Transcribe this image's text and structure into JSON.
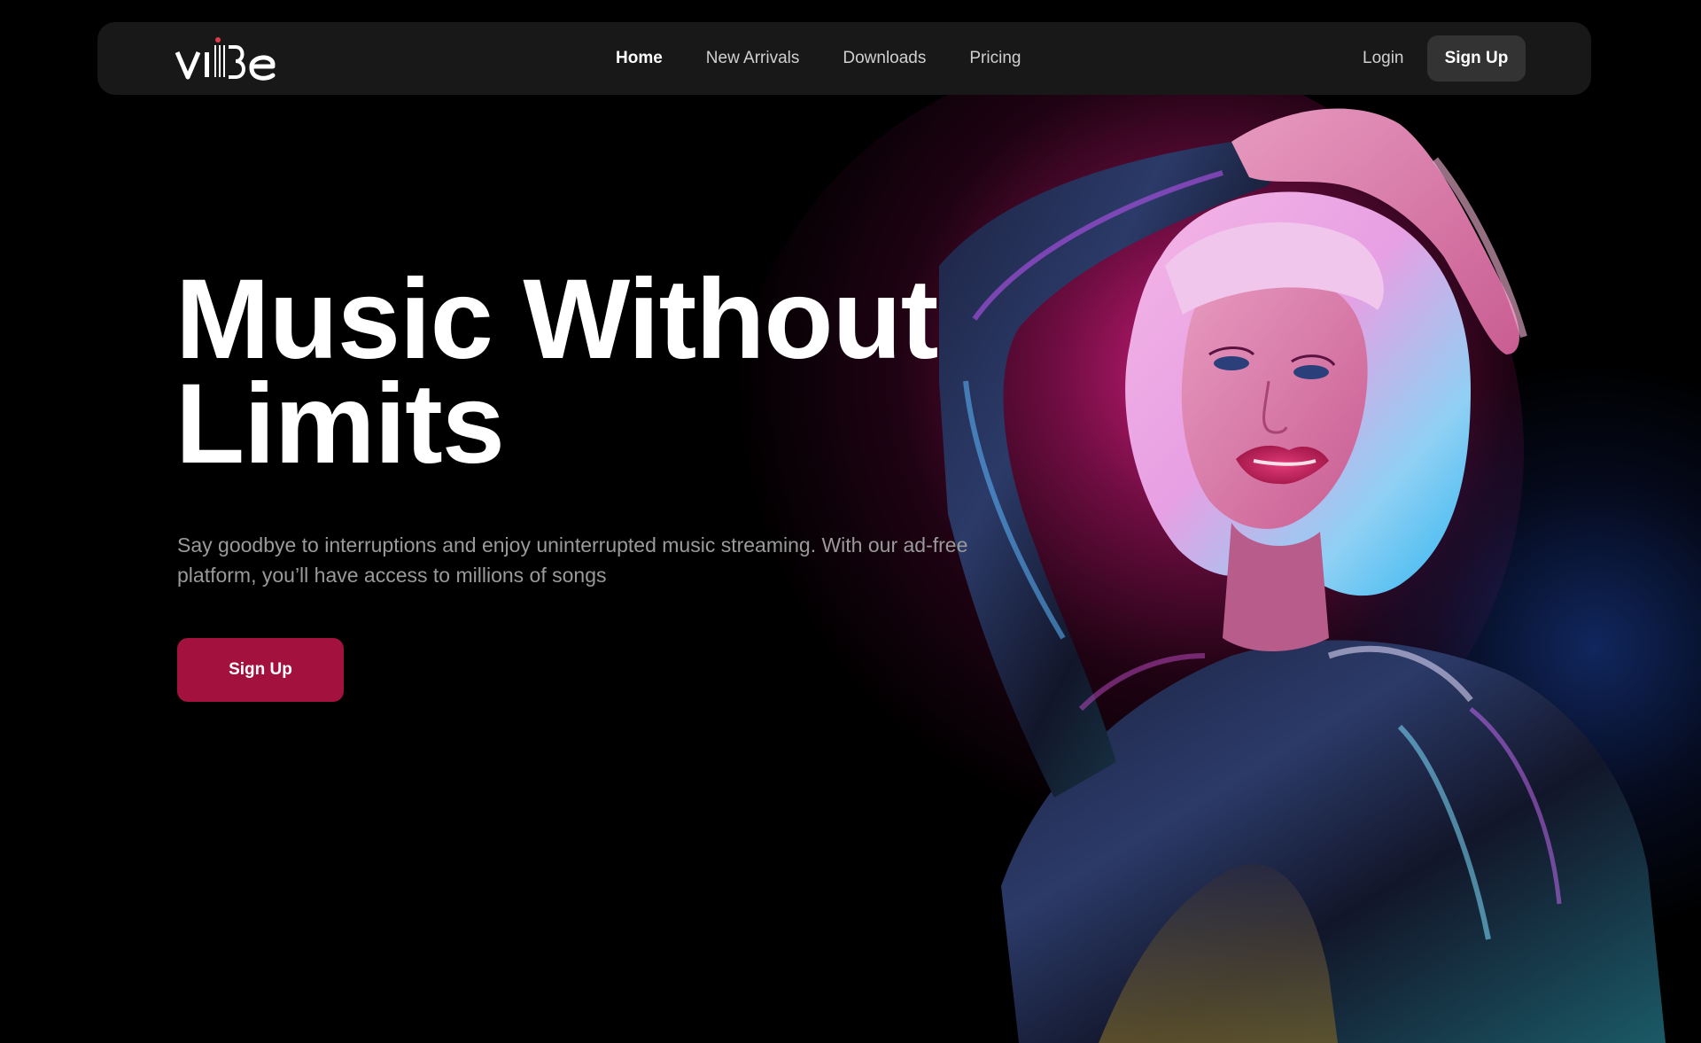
{
  "brand": {
    "logo_text": "vibe",
    "accent_color": "#a3123f",
    "logo_dot_color": "#e23a4a"
  },
  "nav": {
    "links": [
      {
        "label": "Home",
        "active": true
      },
      {
        "label": "New Arrivals",
        "active": false
      },
      {
        "label": "Downloads",
        "active": false
      },
      {
        "label": "Pricing",
        "active": false
      }
    ],
    "login_label": "Login",
    "signup_label": "Sign Up"
  },
  "hero": {
    "title_line1": "Music Without",
    "title_line2": "Limits",
    "subtitle": "Say goodbye to interruptions and enjoy uninterrupted music streaming. With our ad-free platform, you’ll have access to millions of songs",
    "cta_label": "Sign Up",
    "image": "hero-photo-woman-neon-bob-wig"
  }
}
